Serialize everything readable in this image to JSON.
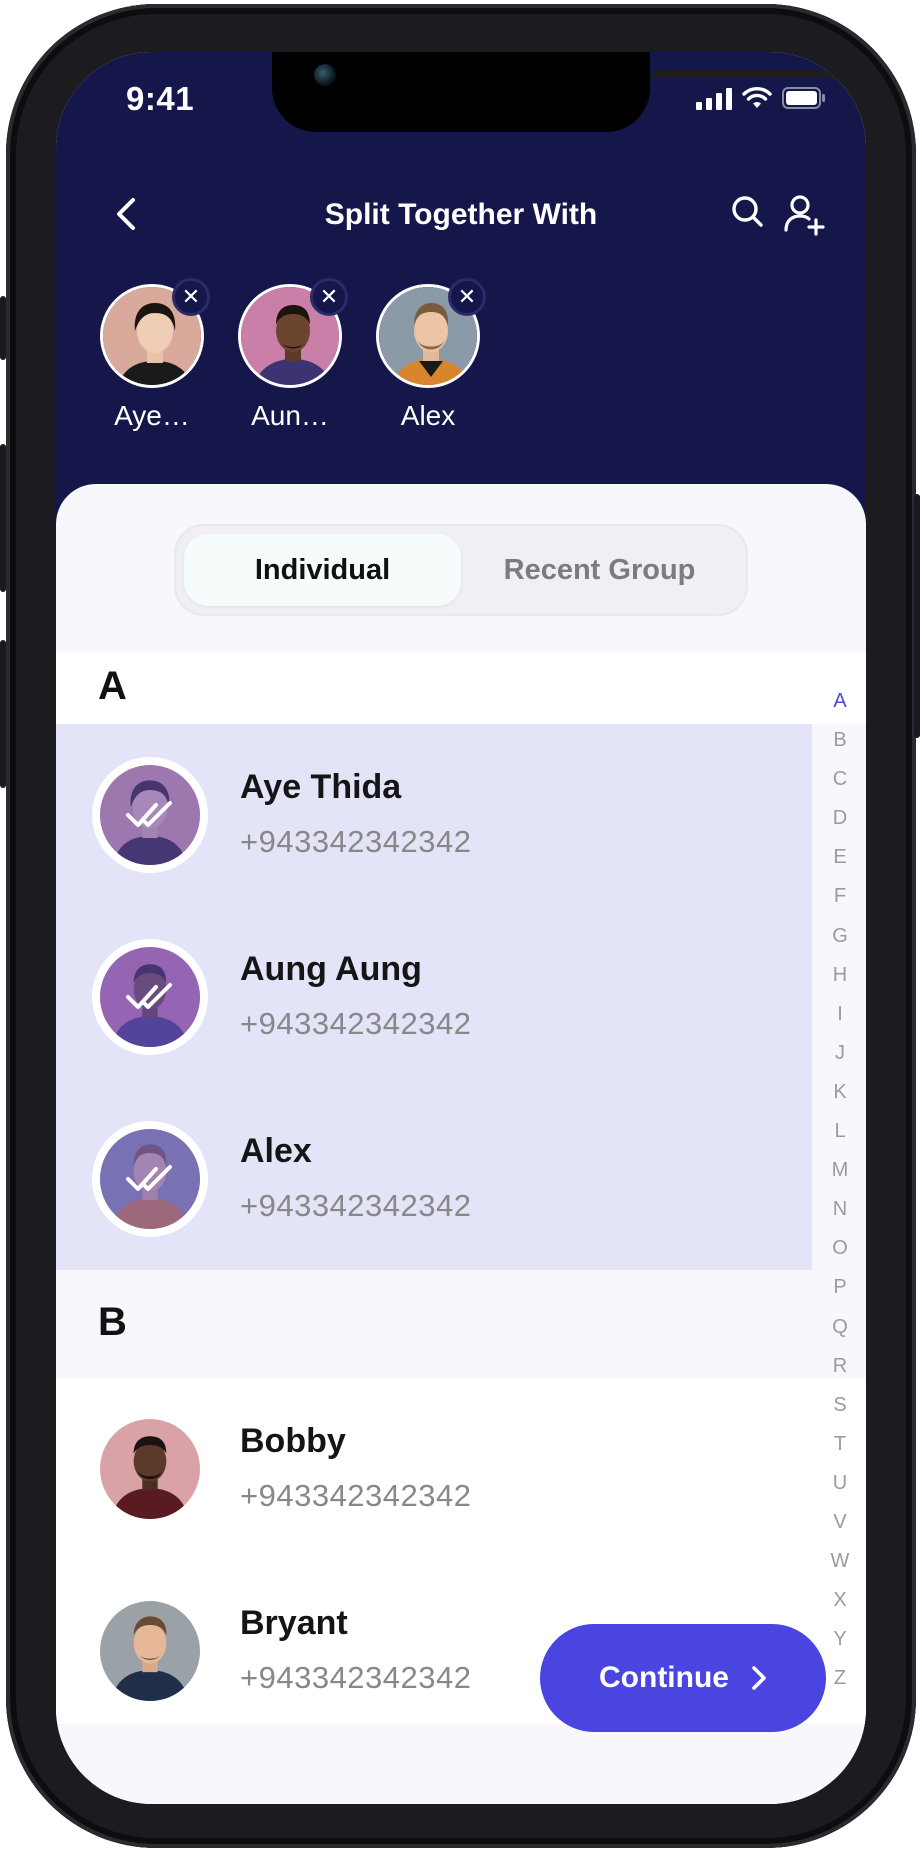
{
  "status_bar": {
    "time": "9:41"
  },
  "header": {
    "title": "Split Together With"
  },
  "selected": [
    {
      "name": "Aye…",
      "avatar": "woman-avatar-1"
    },
    {
      "name": "Aun…",
      "avatar": "man-avatar-1"
    },
    {
      "name": "Alex",
      "avatar": "man-avatar-2"
    }
  ],
  "remove_glyph": "✕",
  "tabs": [
    {
      "label": "Individual",
      "active": true
    },
    {
      "label": "Recent Group",
      "active": false
    }
  ],
  "sections": [
    {
      "letter": "A",
      "contacts": [
        {
          "name": "Aye Thida",
          "phone": "+943342342342",
          "selected": true
        },
        {
          "name": "Aung Aung",
          "phone": "+943342342342",
          "selected": true
        },
        {
          "name": "Alex",
          "phone": "+943342342342",
          "selected": true
        }
      ]
    },
    {
      "letter": "B",
      "contacts": [
        {
          "name": "Bobby",
          "phone": "+943342342342",
          "selected": false
        },
        {
          "name": "Bryant",
          "phone": "+943342342342",
          "selected": false
        }
      ]
    }
  ],
  "alphabet": [
    "A",
    "B",
    "C",
    "D",
    "E",
    "F",
    "G",
    "H",
    "I",
    "J",
    "K",
    "L",
    "M",
    "N",
    "O",
    "P",
    "Q",
    "R",
    "S",
    "T",
    "U",
    "V",
    "W",
    "X",
    "Y",
    "Z"
  ],
  "alphabet_active": "A",
  "continue_label": "Continue",
  "colors": {
    "header": "#15164a",
    "accent": "#4a45e0",
    "selected_row": "#e3e4f8"
  }
}
